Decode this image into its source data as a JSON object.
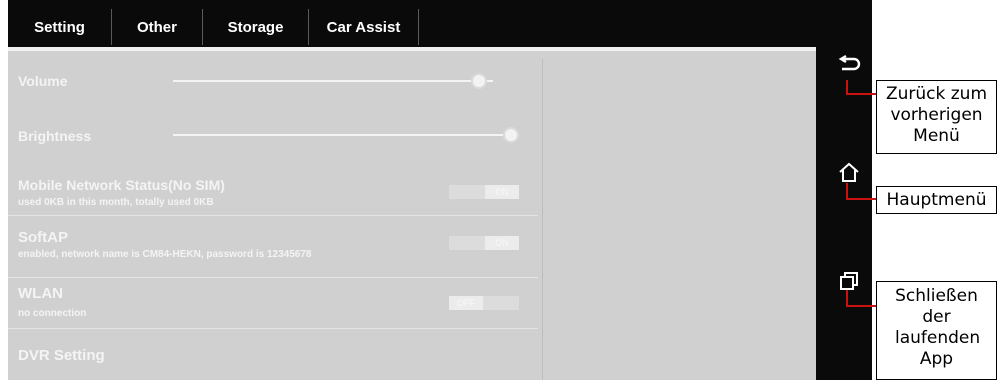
{
  "tabs": [
    {
      "label": "Setting"
    },
    {
      "label": "Other"
    },
    {
      "label": "Storage"
    },
    {
      "label": "Car Assist"
    }
  ],
  "settings": {
    "volume": {
      "label": "Volume",
      "level": 0.98
    },
    "brightness": {
      "label": "Brightness",
      "level": 1.0
    },
    "mobile_network": {
      "label": "Mobile Network Status(No SIM)",
      "sub": "used 0KB in this month, totally used 0KB",
      "toggle": "ON"
    },
    "softap": {
      "label": "SoftAP",
      "sub": "enabled, network name is CM84-HEKN, password is 12345678",
      "toggle": "ON"
    },
    "wlan": {
      "label": "WLAN",
      "sub": "no connection",
      "toggle": "OFF"
    },
    "dvr": {
      "label": "DVR Setting"
    }
  },
  "nav_icons": [
    "back-icon",
    "home-icon",
    "recent-apps-icon"
  ],
  "callouts": {
    "back": "Zurück zum vorherigen Menü",
    "home": "Hauptmenü",
    "close_app": "Schließen der laufenden App"
  },
  "colors": {
    "background": "#0a0a0a",
    "panel": "#d0d0d0",
    "connector": "#cc1111"
  }
}
